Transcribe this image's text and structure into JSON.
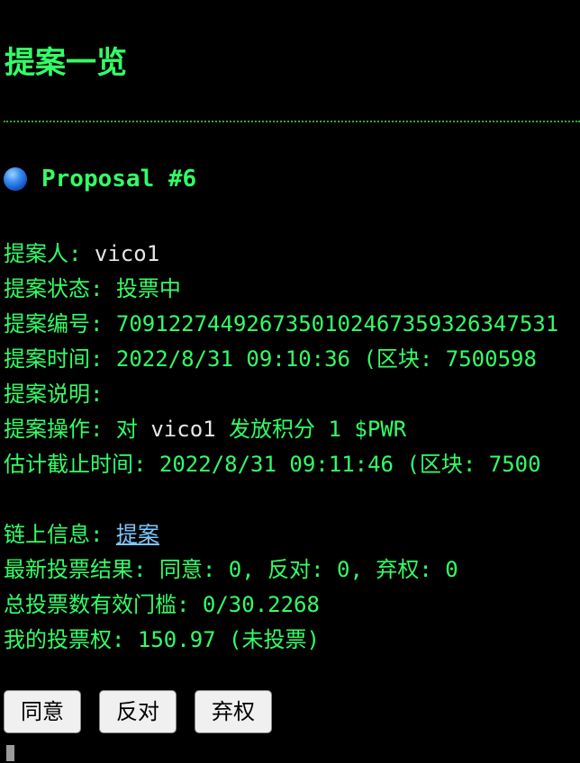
{
  "page": {
    "title": "提案一览"
  },
  "proposal": {
    "icon": "globe-icon",
    "heading": "Proposal #6",
    "fields": [
      {
        "label": "提案人: ",
        "value": "vico1"
      },
      {
        "label": "提案状态: ",
        "value": "投票中"
      },
      {
        "label": "提案编号: ",
        "value": "7091227449267350102467359326347531"
      },
      {
        "label": "提案时间: ",
        "value": "2022/8/31 09:10:36 (区块: 7500598"
      },
      {
        "label": "提案说明: ",
        "value": ""
      },
      {
        "label": "提案操作: ",
        "value_parts": [
          "对 ",
          "vico1",
          " 发放积分 1 $PWR"
        ]
      },
      {
        "label": "估计截止时间: ",
        "value": "2022/8/31 09:11:46 (区块: 7500"
      }
    ],
    "chain_info": {
      "label": "链上信息: ",
      "link_text": "提案"
    },
    "vote_result": {
      "label": "最新投票结果: ",
      "value": "同意: 0, 反对: 0, 弃权: 0"
    },
    "threshold": {
      "label": "总投票数有效门槛: ",
      "value": "0/30.2268"
    },
    "my_power": {
      "label": "我的投票权: ",
      "value": " 150.97 (未投票)"
    }
  },
  "actions": {
    "agree": "同意",
    "oppose": "反对",
    "abstain": "弃权"
  },
  "colors": {
    "background": "#000000",
    "text_green": "#33ff66",
    "link_blue": "#7ec8ff",
    "button_bg": "#f0f0f0"
  }
}
